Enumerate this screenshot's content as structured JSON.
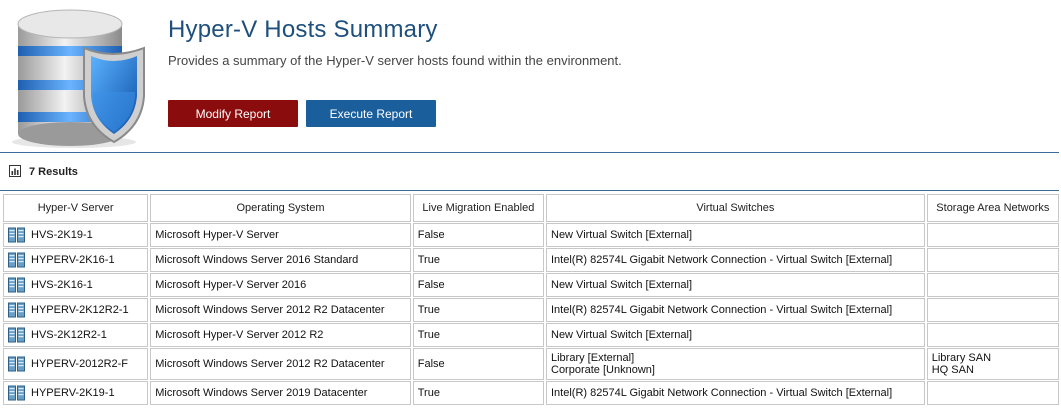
{
  "header": {
    "title": "Hyper-V Hosts Summary",
    "subtitle": "Provides a summary of the Hyper-V server hosts found within the environment.",
    "modify_label": "Modify Report",
    "execute_label": "Execute Report"
  },
  "results": {
    "count_label": "7 Results"
  },
  "table": {
    "columns": [
      "Hyper-V Server",
      "Operating System",
      "Live Migration Enabled",
      "Virtual Switches",
      "Storage Area Networks"
    ],
    "rows": [
      {
        "server": "HVS-2K19-1",
        "os": "Microsoft Hyper-V Server",
        "live_migration": "False",
        "switches": [
          "New Virtual Switch [External]"
        ],
        "sans": []
      },
      {
        "server": "HYPERV-2K16-1",
        "os": "Microsoft Windows Server 2016 Standard",
        "live_migration": "True",
        "switches": [
          "Intel(R) 82574L Gigabit Network Connection - Virtual Switch [External]"
        ],
        "sans": []
      },
      {
        "server": "HVS-2K16-1",
        "os": "Microsoft Hyper-V Server 2016",
        "live_migration": "False",
        "switches": [
          "New Virtual Switch [External]"
        ],
        "sans": []
      },
      {
        "server": "HYPERV-2K12R2-1",
        "os": "Microsoft Windows Server 2012 R2 Datacenter",
        "live_migration": "True",
        "switches": [
          "Intel(R) 82574L Gigabit Network Connection - Virtual Switch [External]"
        ],
        "sans": []
      },
      {
        "server": "HVS-2K12R2-1",
        "os": "Microsoft Hyper-V Server 2012 R2",
        "live_migration": "True",
        "switches": [
          "New Virtual Switch [External]"
        ],
        "sans": []
      },
      {
        "server": "HYPERV-2012R2-F",
        "os": "Microsoft Windows Server 2012 R2 Datacenter",
        "live_migration": "False",
        "switches": [
          "Library [External]",
          "Corporate [Unknown]"
        ],
        "sans": [
          "Library SAN",
          "HQ SAN"
        ]
      },
      {
        "server": "HYPERV-2K19-1",
        "os": "Microsoft Windows Server 2019 Datacenter",
        "live_migration": "True",
        "switches": [
          "Intel(R) 82574L Gigabit Network Connection - Virtual Switch [External]"
        ],
        "sans": []
      }
    ]
  },
  "icons": {
    "logo": "database-shield-icon",
    "results": "report-chart-icon",
    "server": "server-icon"
  },
  "colors": {
    "title": "#1e4f7d",
    "modify_button": "#8b0c0c",
    "execute_button": "#1a5f9c",
    "divider": "#3a6b9a"
  }
}
